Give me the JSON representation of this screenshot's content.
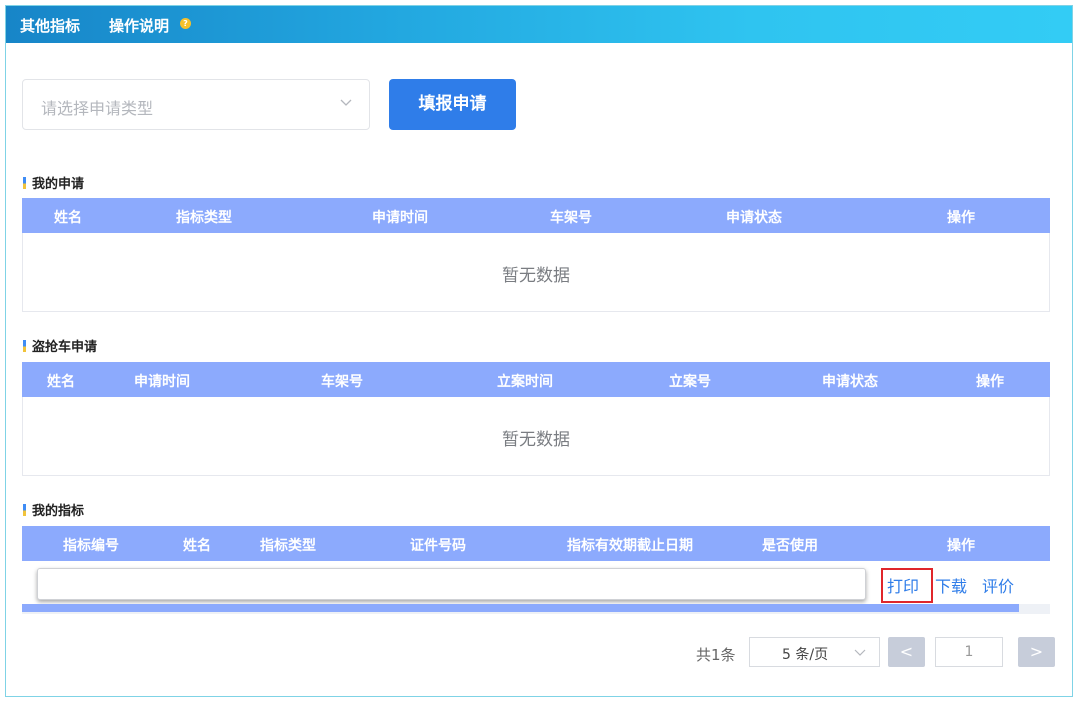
{
  "header": {
    "title": "其他指标",
    "help_label": "操作说明",
    "help_icon": "?"
  },
  "form": {
    "type_select_placeholder": "请选择申请类型",
    "submit_label": "填报申请"
  },
  "my_applications": {
    "title": "我的申请",
    "columns": [
      "姓名",
      "指标类型",
      "申请时间",
      "车架号",
      "申请状态",
      "操作"
    ],
    "empty_text": "暂无数据"
  },
  "theft_applications": {
    "title": "盗抢车申请",
    "columns": [
      "姓名",
      "申请时间",
      "车架号",
      "立案时间",
      "立案号",
      "申请状态",
      "操作"
    ],
    "empty_text": "暂无数据"
  },
  "my_indicators": {
    "title": "我的指标",
    "columns": [
      "指标编号",
      "姓名",
      "指标类型",
      "证件号码",
      "指标有效期截止日期",
      "是否使用",
      "操作"
    ],
    "actions": {
      "print": "打印",
      "download": "下载",
      "rate": "评价"
    }
  },
  "pagination": {
    "total": "共1条",
    "page_size": "5 条/页",
    "prev": "<",
    "current_page": "1",
    "next": ">"
  },
  "colors": {
    "accent": "#2f7de9",
    "table_header": "#8caafd",
    "highlight": "#e0262b"
  }
}
